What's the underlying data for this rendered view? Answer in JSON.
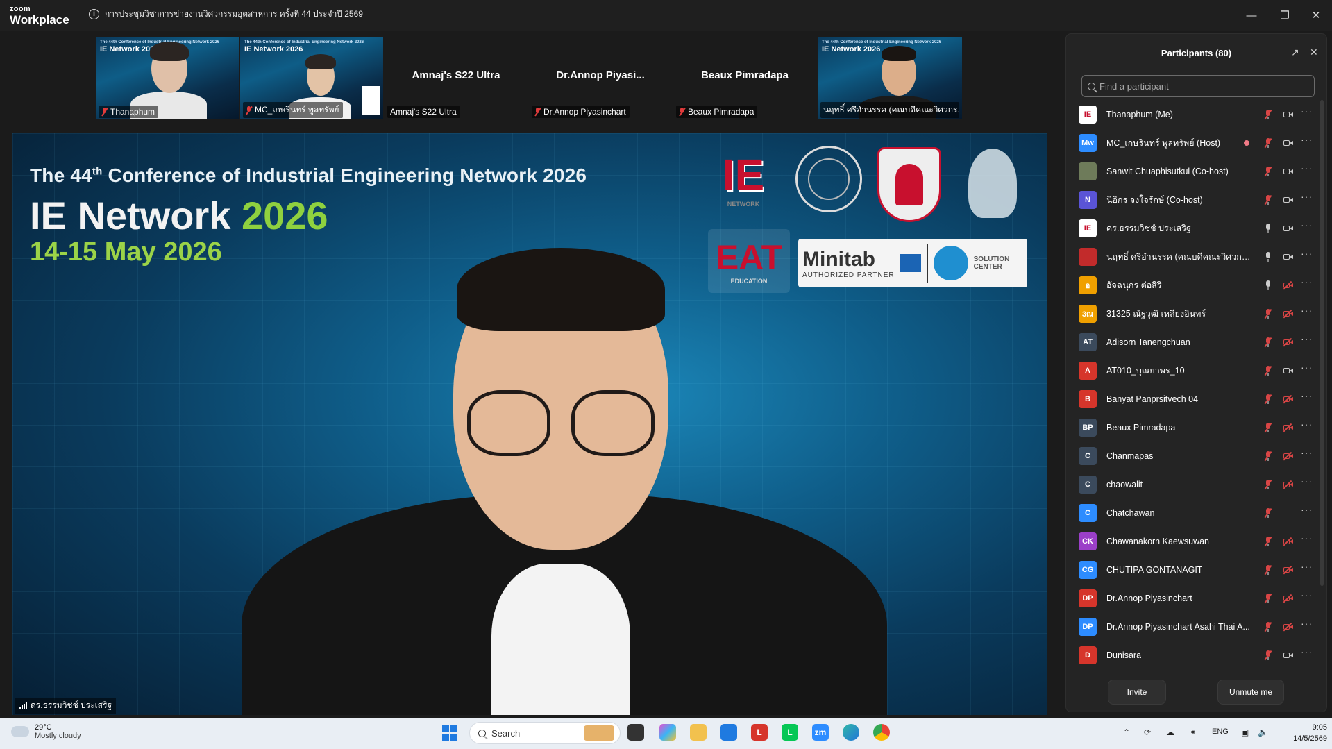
{
  "app": {
    "brand_top": "zoom",
    "brand_bottom": "Workplace",
    "meeting_title": "การประชุมวิชาการข่ายงานวิศวกรรมอุตสาหการ ครั้งที่ 44 ประจำปี 2569"
  },
  "thumbnails": [
    {
      "name": "Thanaphum",
      "type": "video",
      "banner1": "The 44th Conference of Industrial Engineering Network 2026",
      "banner2": "IE Network 2026"
    },
    {
      "name": "MC_เกษรินทร์ พูลทรัพย์",
      "type": "video",
      "banner1": "The 44th Conference of Industrial Engineering Network 2026",
      "banner2": "IE Network 2026"
    },
    {
      "name": "Amnaj's S22 Ultra",
      "type": "noimg",
      "bigname": "Amnaj's S22 Ultra"
    },
    {
      "name": "Dr.Annop Piyasinchart",
      "type": "noimg",
      "bigname": "Dr.Annop  Piyasi..."
    },
    {
      "name": "Beaux Pimradapa",
      "type": "noimg",
      "bigname": "Beaux Pimradapa"
    },
    {
      "name": "นฤทธิ์ ศรีอำนรรค (คณบดีคณะวิศวกร...",
      "type": "video",
      "banner1": "The 44th Conference of Industrial Engineering Network 2026",
      "banner2": "IE Network 2026"
    }
  ],
  "main_video": {
    "conf_title": "The 44",
    "conf_title_sup": "th",
    "conf_title_rest": " Conference of Industrial Engineering Network 2026",
    "ie_network": "IE Network ",
    "ie_year": "2026",
    "dates": "14-15 May 2026",
    "logo_minitab": "Minitab",
    "logo_minitab_sub": "AUTHORIZED PARTNER",
    "logo_solution": "SOLUTION CENTER",
    "logo_eat": "EAT",
    "logo_eat_sub": "EDUCATION",
    "logo_ie": "IE",
    "logo_ie_sub": "NETWORK",
    "speaker_name": "ดร.ธรรมวิชช์ ประเสริฐ"
  },
  "participants": {
    "title": "Participants (80)",
    "search_placeholder": "Find a participant",
    "invite_label": "Invite",
    "unmute_label": "Unmute me",
    "list": [
      {
        "name": "Thanaphum (Me)",
        "initials": "IE",
        "color": "#ffffff",
        "text": "#c8102e",
        "mic": "off",
        "cam": "on",
        "rec": false
      },
      {
        "name": "MC_เกษรินทร์ พูลทรัพย์ (Host)",
        "initials": "Mw",
        "color": "#2d8cff",
        "text": "#ffffff",
        "mic": "off",
        "cam": "on",
        "rec": true
      },
      {
        "name": "Sanwit Chuaphisutkul (Co-host)",
        "initials": "",
        "color": "#6e7b5a",
        "text": "#ffffff",
        "mic": "off",
        "cam": "on",
        "rec": false
      },
      {
        "name": "นิอิกร จงใจรักษ์ (Co-host)",
        "initials": "N",
        "color": "#5a54d6",
        "text": "#ffffff",
        "mic": "off",
        "cam": "on",
        "rec": false
      },
      {
        "name": "ดร.ธรรมวิชช์ ประเสริฐ",
        "initials": "IE",
        "color": "#ffffff",
        "text": "#c8102e",
        "mic": "on",
        "cam": "on",
        "rec": false
      },
      {
        "name": "นฤทธิ์ ศรีอำนรรค (คณบดีคณะวิศวกรรมศ...",
        "initials": "",
        "color": "#c22b2b",
        "text": "#ffffff",
        "mic": "on",
        "cam": "on",
        "rec": false
      },
      {
        "name": "อัจฉนุกร ต่อสิริ",
        "initials": "อ",
        "color": "#f0a000",
        "text": "#ffffff",
        "mic": "on",
        "cam": "off",
        "rec": false
      },
      {
        "name": "31325 ณัฐวุฒิ เหลียงอินทร์",
        "initials": "3ณ",
        "color": "#f0a000",
        "text": "#ffffff",
        "mic": "off",
        "cam": "off",
        "rec": false
      },
      {
        "name": "Adisorn  Tanengchuan",
        "initials": "AT",
        "color": "#3b4a5c",
        "text": "#ffffff",
        "mic": "off",
        "cam": "off",
        "rec": false
      },
      {
        "name": "AT010_บุณยาพร_10",
        "initials": "A",
        "color": "#d6352b",
        "text": "#ffffff",
        "mic": "off",
        "cam": "on",
        "rec": false
      },
      {
        "name": "Banyat Panprsitvech 04",
        "initials": "B",
        "color": "#d6352b",
        "text": "#ffffff",
        "mic": "off",
        "cam": "off",
        "rec": false
      },
      {
        "name": "Beaux Pimradapa",
        "initials": "BP",
        "color": "#3b4a5c",
        "text": "#ffffff",
        "mic": "off",
        "cam": "off",
        "rec": false
      },
      {
        "name": "Chanmapas",
        "initials": "C",
        "color": "#3b4a5c",
        "text": "#ffffff",
        "mic": "off",
        "cam": "off",
        "rec": false
      },
      {
        "name": "chaowalit",
        "initials": "C",
        "color": "#3b4a5c",
        "text": "#ffffff",
        "mic": "off",
        "cam": "off",
        "rec": false
      },
      {
        "name": "Chatchawan",
        "initials": "C",
        "color": "#2d8cff",
        "text": "#ffffff",
        "mic": "off",
        "cam": "none",
        "rec": false
      },
      {
        "name": "Chawanakorn Kaewsuwan",
        "initials": "CK",
        "color": "#9b3fc8",
        "text": "#ffffff",
        "mic": "off",
        "cam": "off",
        "rec": false
      },
      {
        "name": "CHUTIPA GONTANAGIT",
        "initials": "CG",
        "color": "#2d8cff",
        "text": "#ffffff",
        "mic": "off",
        "cam": "off",
        "rec": false
      },
      {
        "name": "Dr.Annop Piyasinchart",
        "initials": "DP",
        "color": "#d6352b",
        "text": "#ffffff",
        "mic": "off",
        "cam": "off",
        "rec": false
      },
      {
        "name": "Dr.Annop Piyasinchart Asahi Thai A...",
        "initials": "DP",
        "color": "#2d8cff",
        "text": "#ffffff",
        "mic": "off",
        "cam": "off",
        "rec": false
      },
      {
        "name": "Dunisara",
        "initials": "D",
        "color": "#d6352b",
        "text": "#ffffff",
        "mic": "off",
        "cam": "on",
        "rec": false
      }
    ]
  },
  "taskbar": {
    "temp": "29°C",
    "weather": "Mostly cloudy",
    "search_label": "Search",
    "lang": "ENG",
    "time": "9:05",
    "date": "14/5/2569"
  }
}
